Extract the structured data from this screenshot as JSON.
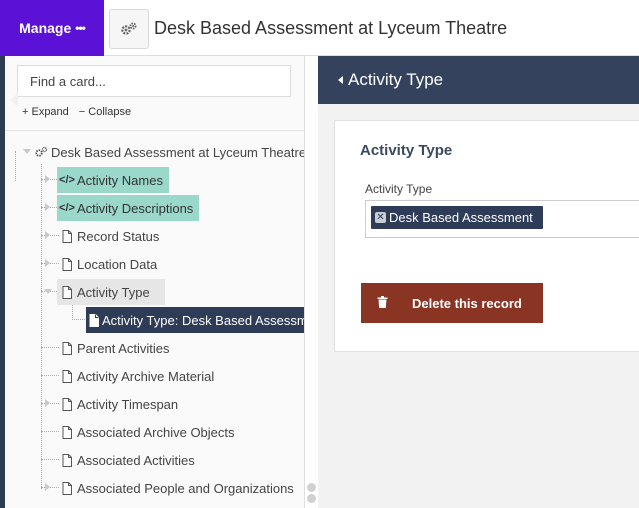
{
  "header": {
    "manage_label": "Manage",
    "manage_dots": "•••",
    "resource_icon": "gears-icon",
    "title": "Desk Based Assessment at Lyceum Theatre"
  },
  "card_panel": {
    "search_placeholder": "Find a card...",
    "expand_label": "+ Expand",
    "collapse_label": "− Collapse",
    "tree": {
      "root": {
        "label": "Desk Based Assessment at Lyceum Theatre",
        "icon": "gears-icon"
      },
      "items": [
        {
          "label": "Activity Names",
          "icon": "code-icon"
        },
        {
          "label": "Activity Descriptions",
          "icon": "code-icon"
        },
        {
          "label": "Record Status",
          "icon": "file-icon"
        },
        {
          "label": "Location Data",
          "icon": "file-icon"
        },
        {
          "label": "Activity Type",
          "icon": "file-icon"
        },
        {
          "label": "Activity Type: Desk Based Assessment",
          "icon": "file-icon"
        },
        {
          "label": "Parent Activities",
          "icon": "file-icon"
        },
        {
          "label": "Activity Archive Material",
          "icon": "file-icon"
        },
        {
          "label": "Activity Timespan",
          "icon": "file-icon"
        },
        {
          "label": "Associated Archive Objects",
          "icon": "file-icon"
        },
        {
          "label": "Associated Activities",
          "icon": "file-icon"
        },
        {
          "label": "Associated People and Organizations",
          "icon": "file-icon"
        }
      ]
    }
  },
  "form": {
    "header_title": "Activity Type",
    "card_title": "Activity Type",
    "field_label": "Activity Type",
    "selected_value": "Desk Based Assessment",
    "delete_label": "Delete this record"
  },
  "colors": {
    "manage_purple": "#5c11d6",
    "navy": "#2e3c57",
    "header_navy": "#34425e",
    "teal_highlight": "#9ad8cc",
    "delete_red": "#8a3424"
  }
}
